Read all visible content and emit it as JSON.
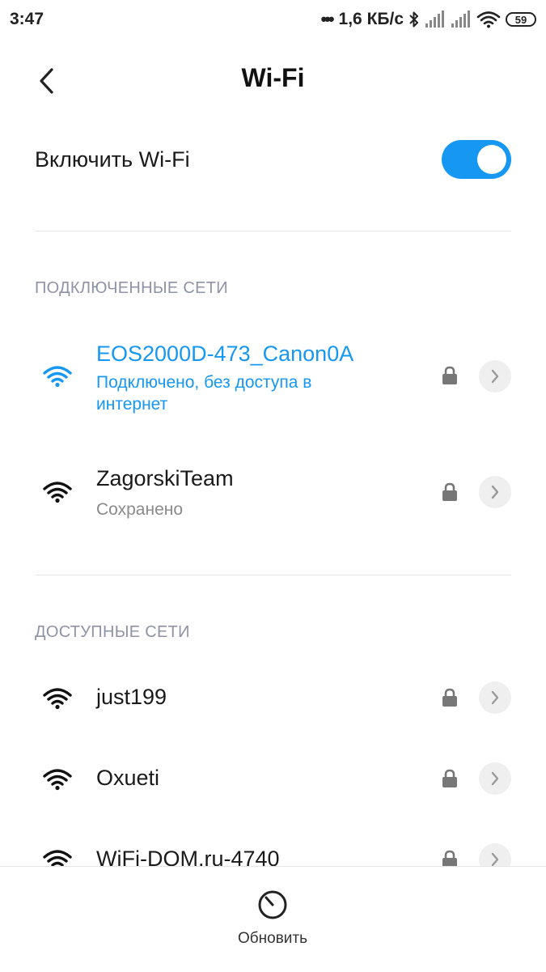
{
  "status_bar": {
    "time": "3:47",
    "dots": "•••",
    "net_speed": "1,6 КБ/с",
    "battery": "59",
    "icons": [
      "bluetooth-icon",
      "signal-icon",
      "signal-icon",
      "wifi-icon",
      "battery-icon"
    ]
  },
  "header": {
    "title": "Wi-Fi",
    "back_icon": "chevron-left-icon"
  },
  "toggle": {
    "label": "Включить Wi-Fi",
    "state": "on",
    "accent_color": "#1597f2"
  },
  "connected": {
    "header": "ПОДКЛЮЧЕННЫЕ СЕТИ",
    "networks": [
      {
        "name": "EOS2000D-473_Canon0A",
        "status": "Подключено, без доступа в интернет",
        "active": true,
        "secured": true
      },
      {
        "name": "ZagorskiTeam",
        "status": "Сохранено",
        "active": false,
        "secured": true
      }
    ]
  },
  "available": {
    "header": "ДОСТУПНЫЕ СЕТИ",
    "networks": [
      {
        "name": "just199",
        "secured": true
      },
      {
        "name": "Oxueti",
        "secured": true
      },
      {
        "name": "WiFi-DOM.ru-4740",
        "secured": true
      }
    ]
  },
  "bottom": {
    "refresh_label": "Обновить",
    "refresh_icon": "refresh-icon"
  }
}
